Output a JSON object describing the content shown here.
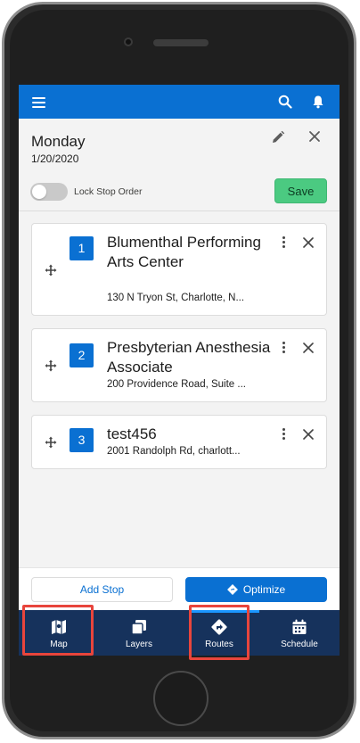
{
  "header": {
    "day": "Monday",
    "date": "1/20/2020"
  },
  "lock": {
    "label": "Lock Stop Order",
    "enabled": false
  },
  "save_label": "Save",
  "stops": [
    {
      "number": "1",
      "name": "Blumenthal Performing Arts Center",
      "address": "130 N Tryon St, Charlotte, N..."
    },
    {
      "number": "2",
      "name": "Presbyterian Anesthesia Associate",
      "address": "200 Providence Road, Suite ..."
    },
    {
      "number": "3",
      "name": "test456",
      "address": "2001 Randolph Rd, charlott..."
    }
  ],
  "actions": {
    "add_stop": "Add Stop",
    "optimize": "Optimize"
  },
  "nav": [
    {
      "label": "Map",
      "icon": "map-icon"
    },
    {
      "label": "Layers",
      "icon": "layers-icon"
    },
    {
      "label": "Routes",
      "icon": "routes-icon",
      "active": true
    },
    {
      "label": "Schedule",
      "icon": "calendar-icon"
    }
  ],
  "colors": {
    "brand": "#0a70d2",
    "nav_bg": "#16325c",
    "save": "#4bca81",
    "highlight": "#e8453c"
  }
}
